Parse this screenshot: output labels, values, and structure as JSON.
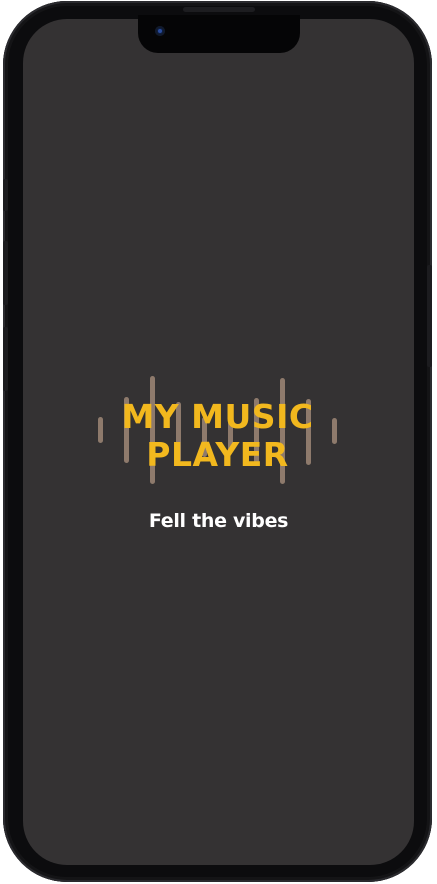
{
  "app": {
    "title_line1": "MY MUSIC",
    "title_line2": "PLAYER",
    "tagline": "Fell the vibes"
  },
  "colors": {
    "background": "#343233",
    "title": "#f2b81e",
    "tagline": "#ffffff",
    "equalizer_bars": "#8e7a6c"
  },
  "icons": {
    "logo_background": "equalizer-bars-icon"
  }
}
